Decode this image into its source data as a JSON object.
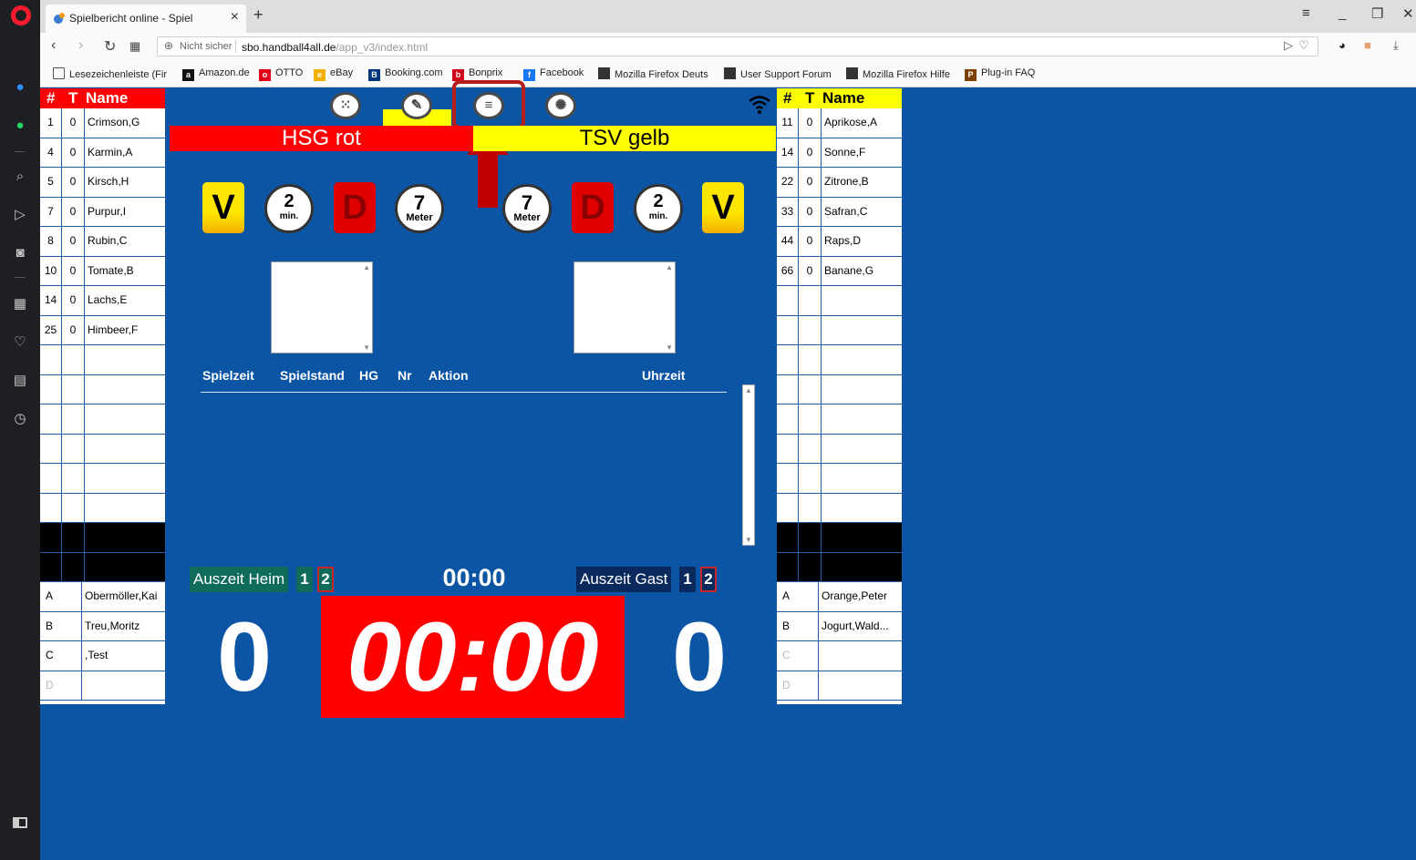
{
  "browser": {
    "tab_title": "Spielbericht online - Spiel",
    "not_secure": "Nicht sicher",
    "url_host": "sbo.handball4all.de",
    "url_path": "/app_v3/index.html",
    "bookmarks": [
      {
        "label": "Lesezeichenleiste (Fir",
        "icon": "folder-icon"
      },
      {
        "label": "Amazon.de",
        "icon": "amazon-icon",
        "color": "#111111"
      },
      {
        "label": "OTTO",
        "icon": "otto-icon",
        "color": "#e3001b"
      },
      {
        "label": "eBay",
        "icon": "ebay-icon",
        "color": "#f5af02"
      },
      {
        "label": "Booking.com",
        "icon": "booking-icon",
        "color": "#003580"
      },
      {
        "label": "Bonprix",
        "icon": "bonprix-icon",
        "color": "#d0021b"
      },
      {
        "label": "Facebook",
        "icon": "facebook-icon",
        "color": "#1877f2"
      },
      {
        "label": "Mozilla Firefox Deuts",
        "icon": "page-icon",
        "color": "#333333"
      },
      {
        "label": "User Support Forum",
        "icon": "page-icon",
        "color": "#333333"
      },
      {
        "label": "Mozilla Firefox Hilfe",
        "icon": "page-icon",
        "color": "#333333"
      },
      {
        "label": "Plug-in FAQ",
        "icon": "plugin-icon",
        "color": "#7b3f00"
      }
    ]
  },
  "roster_header": {
    "num": "#",
    "t": "T",
    "name": "Name"
  },
  "home": {
    "team_name": "HSG rot",
    "color": "#ff0000",
    "players": [
      {
        "num": "1",
        "t": "0",
        "name": "Crimson,G"
      },
      {
        "num": "4",
        "t": "0",
        "name": "Karmin,A"
      },
      {
        "num": "5",
        "t": "0",
        "name": "Kirsch,H"
      },
      {
        "num": "7",
        "t": "0",
        "name": "Purpur,I"
      },
      {
        "num": "8",
        "t": "0",
        "name": "Rubin,C"
      },
      {
        "num": "10",
        "t": "0",
        "name": "Tomate,B"
      },
      {
        "num": "14",
        "t": "0",
        "name": "Lachs,E"
      },
      {
        "num": "25",
        "t": "0",
        "name": "Himbeer,F"
      }
    ],
    "officials": [
      {
        "letter": "A",
        "name": "Obermöller,Kai"
      },
      {
        "letter": "B",
        "name": "Treu,Moritz"
      },
      {
        "letter": "C",
        "name": ",Test"
      },
      {
        "letter": "D",
        "name": ""
      }
    ],
    "timeout_label": "Auszeit Heim",
    "timeout_1": "1",
    "timeout_2": "2",
    "score": "0"
  },
  "guest": {
    "team_name": "TSV gelb",
    "color": "#ffff00",
    "players": [
      {
        "num": "11",
        "t": "0",
        "name": "Aprikose,A"
      },
      {
        "num": "14",
        "t": "0",
        "name": "Sonne,F"
      },
      {
        "num": "22",
        "t": "0",
        "name": "Zitrone,B"
      },
      {
        "num": "33",
        "t": "0",
        "name": "Safran,C"
      },
      {
        "num": "44",
        "t": "0",
        "name": "Raps,D"
      },
      {
        "num": "66",
        "t": "0",
        "name": "Banane,G"
      }
    ],
    "officials": [
      {
        "letter": "A",
        "name": "Orange,Peter"
      },
      {
        "letter": "B",
        "name": "Jogurt,Wald..."
      },
      {
        "letter": "C",
        "name": ""
      },
      {
        "letter": "D",
        "name": ""
      }
    ],
    "timeout_label": "Auszeit Gast",
    "timeout_1": "1",
    "timeout_2": "2",
    "score": "0"
  },
  "actions": {
    "warning": "V",
    "disqualification": "D",
    "suspension_num": "2",
    "suspension_unit": "min.",
    "penalty_num": "7",
    "penalty_unit": "Meter"
  },
  "log_columns": [
    "Spielzeit",
    "Spielstand",
    "HG",
    "Nr",
    "Aktion",
    "Uhrzeit"
  ],
  "clock": {
    "timeout_clock": "00:00",
    "game_clock": "00:00"
  },
  "top_nav": [
    "keypad-icon",
    "edit-icon",
    "list-icon",
    "settings-icon"
  ]
}
